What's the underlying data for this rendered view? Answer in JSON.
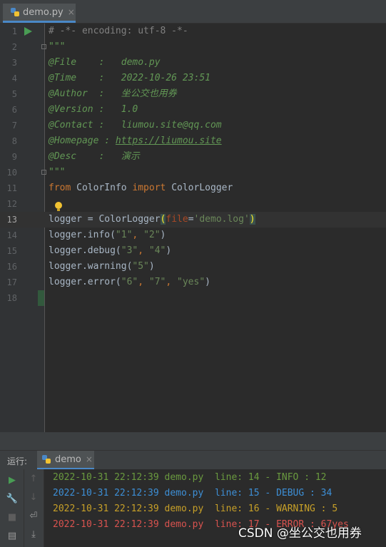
{
  "tab": {
    "filename": "demo.py",
    "close": "×"
  },
  "editor": {
    "lines": [
      {
        "n": "1"
      },
      {
        "n": "2"
      },
      {
        "n": "3"
      },
      {
        "n": "4"
      },
      {
        "n": "5"
      },
      {
        "n": "6"
      },
      {
        "n": "7"
      },
      {
        "n": "8"
      },
      {
        "n": "9"
      },
      {
        "n": "10"
      },
      {
        "n": "11"
      },
      {
        "n": "12"
      },
      {
        "n": "13"
      },
      {
        "n": "14"
      },
      {
        "n": "15"
      },
      {
        "n": "16"
      },
      {
        "n": "17"
      },
      {
        "n": "18"
      }
    ],
    "code": {
      "l1": "# -*- encoding: utf-8 -*-",
      "l2": "\"\"\"",
      "l3": "@File    :   demo.py",
      "l4": "@Time    :   2022-10-26 23:51",
      "l5": "@Author  :   坐公交也用券",
      "l6": "@Version :   1.0",
      "l7": "@Contact :   liumou.site@qq.com",
      "l8_key": "@Homepage : ",
      "l8_link": "https://liumou.site",
      "l9": "@Desc    :   演示",
      "l10": "\"\"\"",
      "l11_kw1": "from",
      "l11_mod": " ColorInfo ",
      "l11_kw2": "import",
      "l11_name": " ColorLogger",
      "l13_a": "logger = ColorLogger",
      "l13_open": "(",
      "l13_param": "file",
      "l13_eq": "=",
      "l13_str": "'demo.log'",
      "l13_close": ")",
      "l14_a": "logger.info(",
      "l14_s1": "\"1\"",
      "l14_c": ", ",
      "l14_s2": "\"2\"",
      "l14_e": ")",
      "l15_a": "logger.debug(",
      "l15_s1": "\"3\"",
      "l15_c": ", ",
      "l15_s2": "\"4\"",
      "l15_e": ")",
      "l16_a": "logger.warning(",
      "l16_s1": "\"5\"",
      "l16_e": ")",
      "l17_a": "logger.error(",
      "l17_s1": "\"6\"",
      "l17_c1": ", ",
      "l17_s2": "\"7\"",
      "l17_c2": ", ",
      "l17_s3": "\"yes\"",
      "l17_e": ")"
    }
  },
  "run": {
    "label": "运行:",
    "tab": "demo",
    "close": "×",
    "output": [
      "2022-10-31 22:12:39 demo.py  line: 14 - INFO : 12",
      "2022-10-31 22:12:39 demo.py  line: 15 - DEBUG : 34",
      "2022-10-31 22:12:39 demo.py  line: 16 - WARNING : 5",
      "2022-10-31 22:12:39 demo.py  line: 17 - ERROR : 67yes"
    ]
  },
  "watermark": "CSDN @坐公交也用券",
  "colors": {
    "info": "#6a9a3f",
    "debug": "#3d8fd6",
    "warning": "#c7a028",
    "error": "#d9534f"
  }
}
